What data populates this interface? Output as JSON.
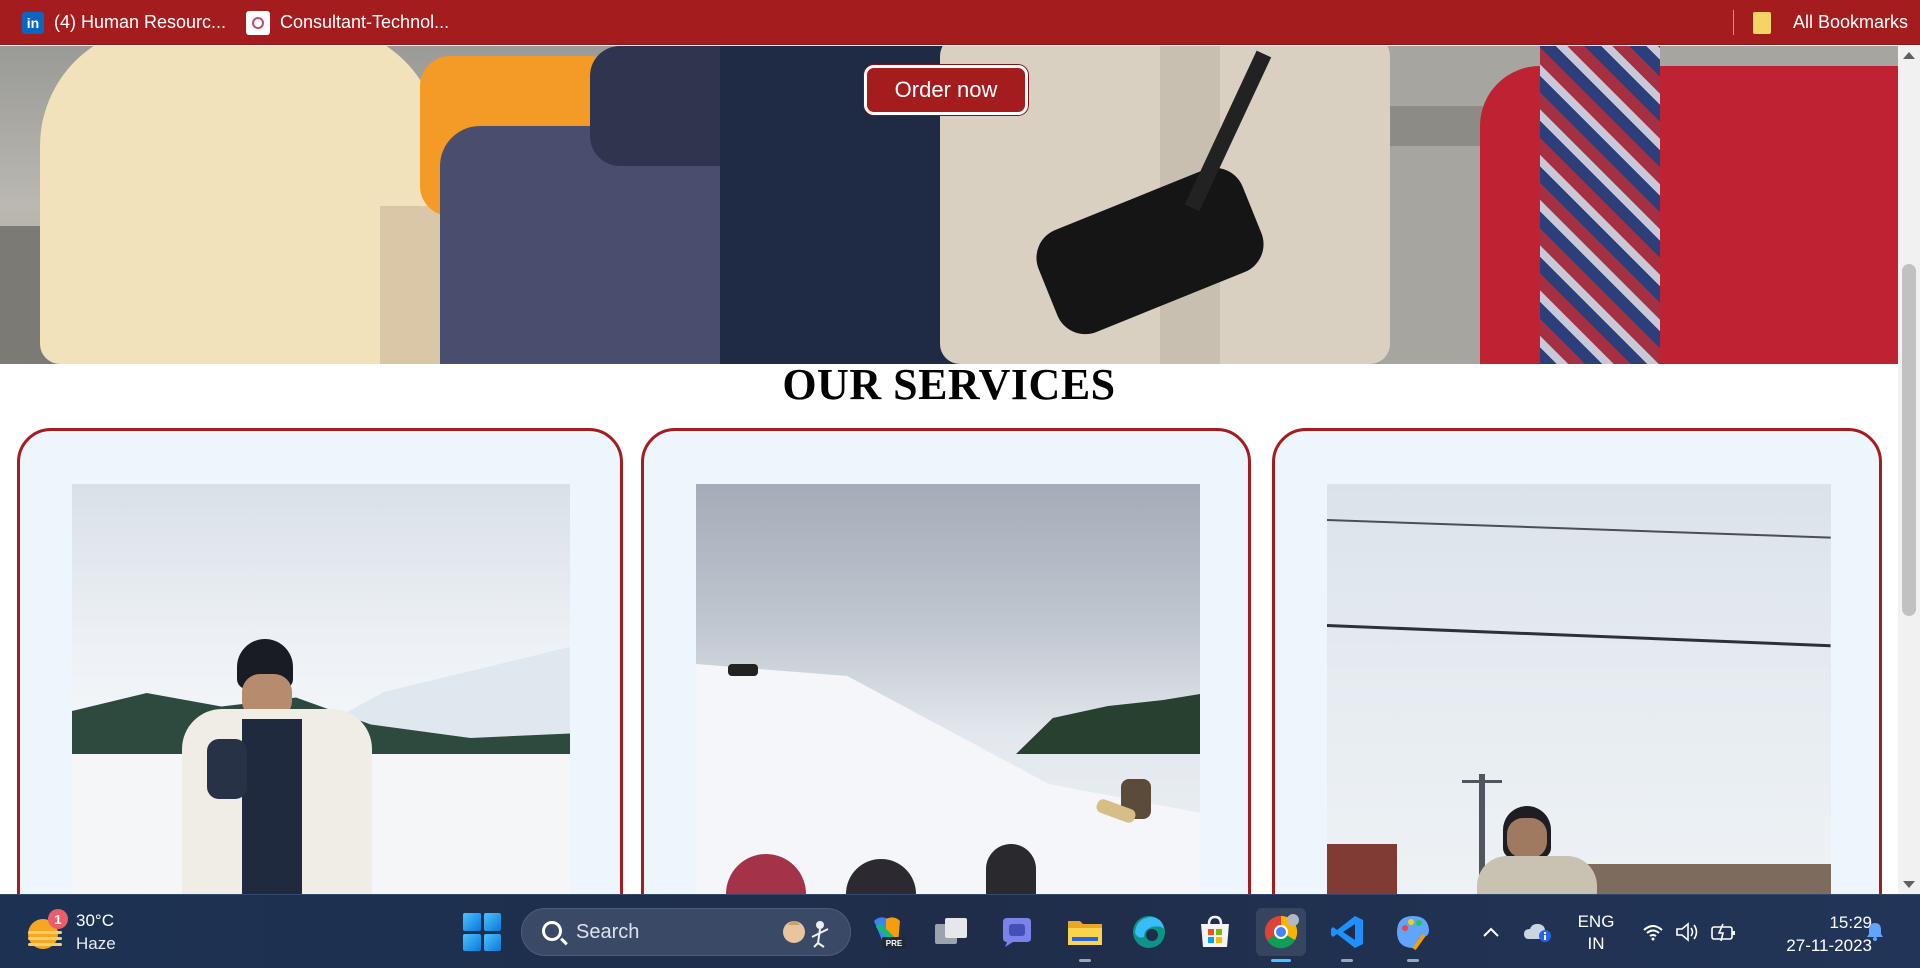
{
  "bookmarks": {
    "items": [
      {
        "label": "(4) Human Resourc...",
        "icon": "linkedin-icon"
      },
      {
        "label": "Consultant-Technol...",
        "icon": "site-favicon"
      }
    ],
    "all_bookmarks": "All Bookmarks"
  },
  "hero": {
    "order_button": "Order now"
  },
  "services": {
    "title": "OUR SERVICES"
  },
  "taskbar": {
    "weather": {
      "badge": "1",
      "temp": "30°C",
      "desc": "Haze"
    },
    "search": {
      "placeholder": "Search"
    },
    "lang": {
      "line1": "ENG",
      "line2": "IN"
    },
    "clock": {
      "time": "15:29",
      "date": "27-11-2023"
    },
    "apps": [
      "copilot-icon",
      "task-view-icon",
      "teams-chat-icon",
      "file-explorer-icon",
      "edge-icon",
      "microsoft-store-icon",
      "chrome-icon",
      "vscode-icon",
      "paint-icon"
    ]
  },
  "colors": {
    "brand_red": "#a51c1e",
    "card_bg": "#eef6fd",
    "taskbar_bg": "#1f2d4a"
  }
}
